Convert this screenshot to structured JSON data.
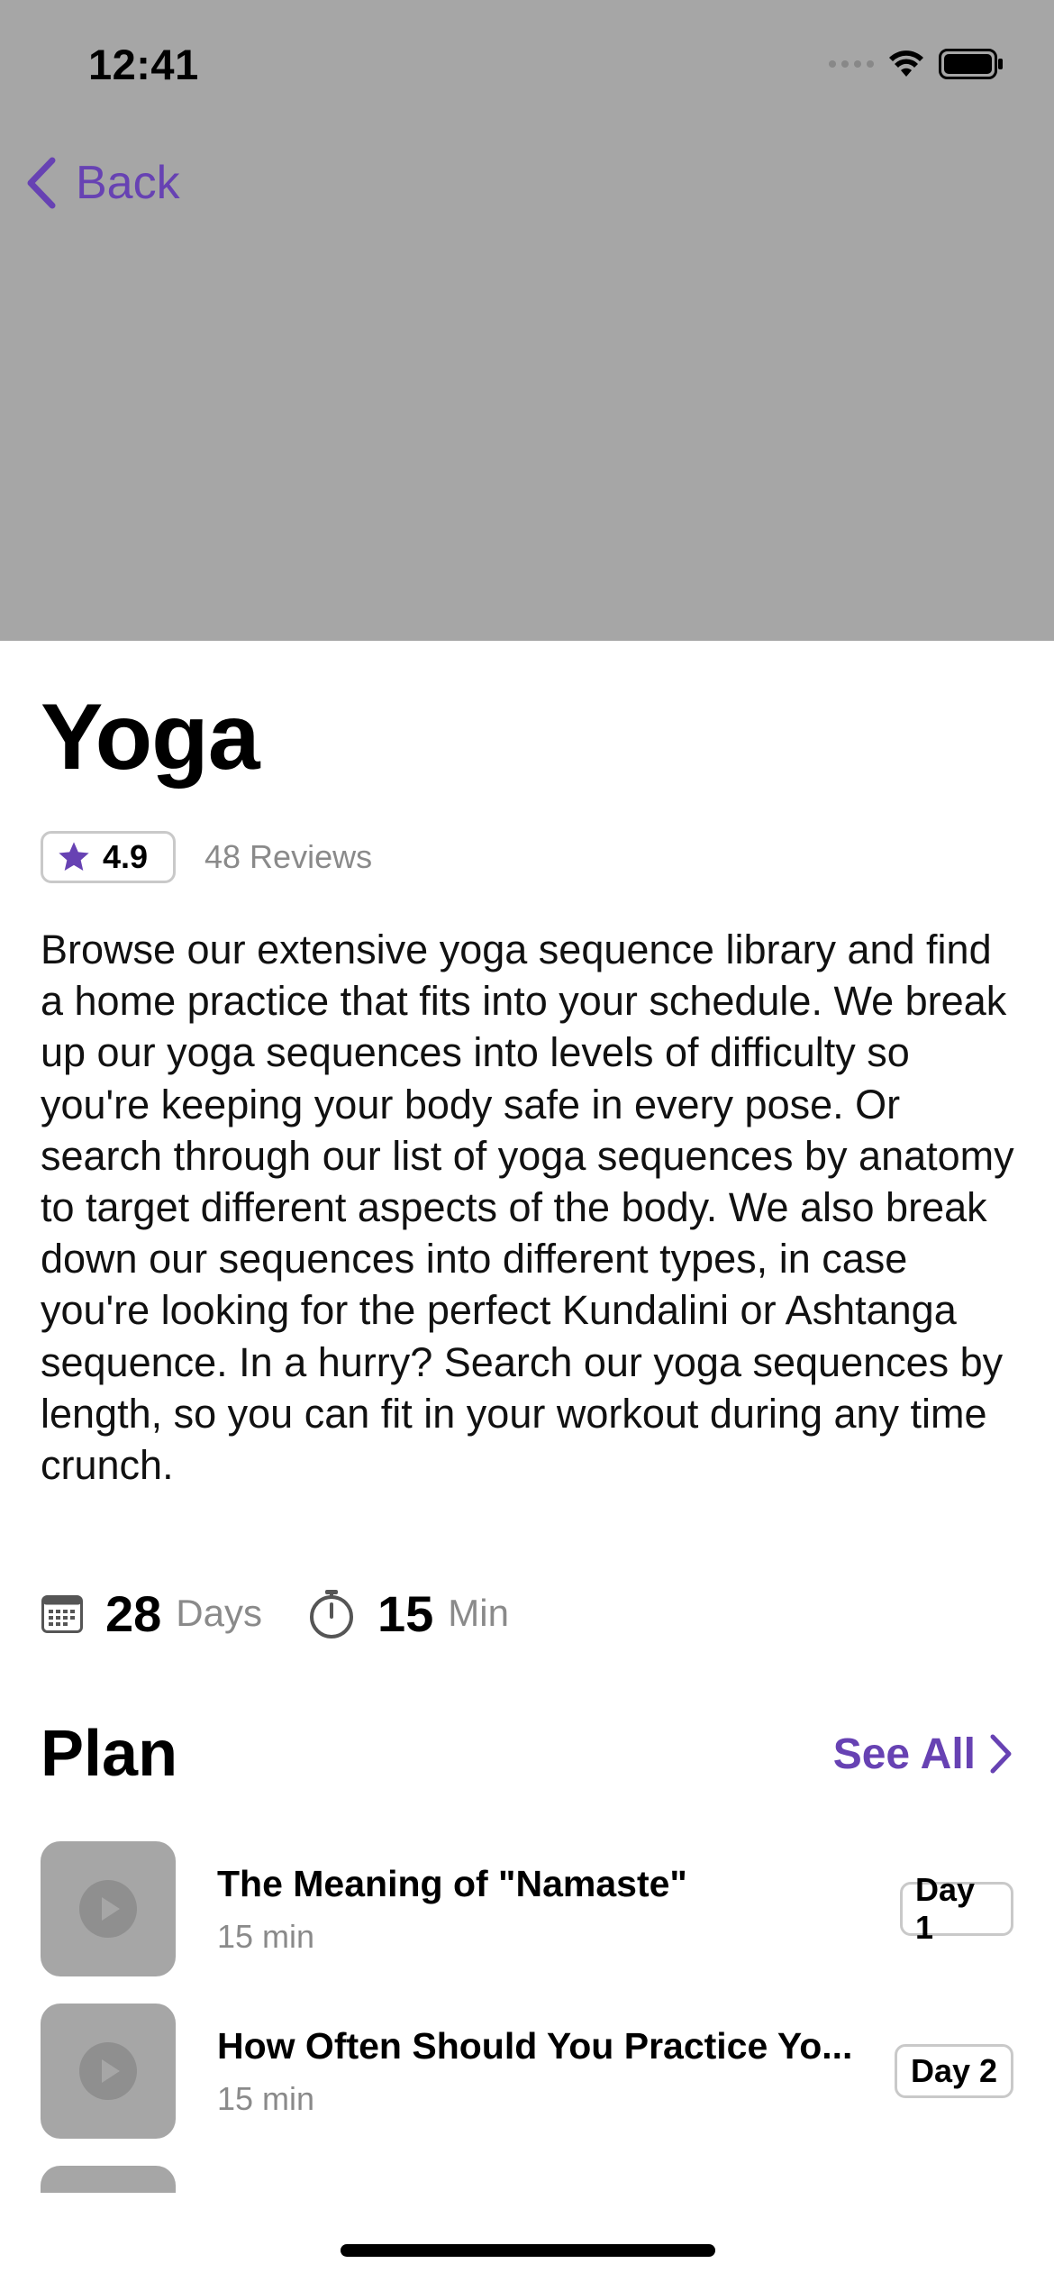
{
  "status_bar": {
    "time": "12:41"
  },
  "nav": {
    "back_label": "Back"
  },
  "program": {
    "title": "Yoga",
    "rating": "4.9",
    "reviews": "48 Reviews",
    "description": "Browse our extensive yoga sequence library and find a home practice that fits into your schedule. We break up our yoga sequences into levels of difficulty so you're keeping your body safe in every pose. Or search through our list of yoga sequences by anatomy to target different aspects of the body. We also break down our sequences into different types, in case you're looking for the perfect Kundalini or Ashtanga sequence. In a hurry? Search our yoga sequences by length, so you can fit in your workout during any time crunch.",
    "stats": {
      "days_value": "28",
      "days_unit": "Days",
      "min_value": "15",
      "min_unit": "Min"
    }
  },
  "plan": {
    "title": "Plan",
    "see_all_label": "See All",
    "items": [
      {
        "title": "The Meaning of \"Namaste\"",
        "duration": "15 min",
        "day": "Day 1"
      },
      {
        "title": "How Often Should You Practice Yo...",
        "duration": "15 min",
        "day": "Day 2"
      }
    ]
  },
  "colors": {
    "accent": "#6742b3",
    "hero_placeholder": "#a6a6a6",
    "secondary_text": "#8a8a8a"
  },
  "icons": [
    "back-chevron-icon",
    "star-icon",
    "calendar-icon",
    "stopwatch-icon",
    "chevron-right-icon",
    "play-icon",
    "wifi-icon",
    "battery-icon",
    "signal-icon"
  ]
}
